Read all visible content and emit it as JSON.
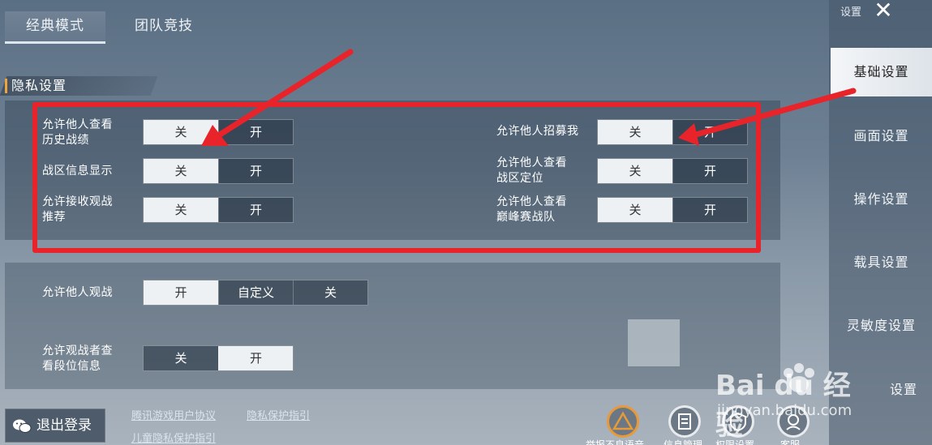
{
  "tabs": [
    "经典模式",
    "团队竞技"
  ],
  "section_title": "隐私设置",
  "privacy": {
    "history": {
      "label_line1": "允许他人查看",
      "label_line2": "历史战绩",
      "off": "关",
      "on": "开",
      "selected": "关"
    },
    "region": {
      "label": "战区信息显示",
      "off": "关",
      "on": "开",
      "selected": "关"
    },
    "spectate_rec": {
      "label_line1": "允许接收观战",
      "label_line2": "推荐",
      "off": "关",
      "on": "开",
      "selected": "关"
    },
    "recruit": {
      "label": "允许他人招募我",
      "off": "关",
      "on": "开",
      "selected": "关"
    },
    "region_loc": {
      "label_line1": "允许他人查看",
      "label_line2": "战区定位",
      "off": "关",
      "on": "开",
      "selected": "关"
    },
    "peak_team": {
      "label_line1": "允许他人查看",
      "label_line2": "巅峰赛战队",
      "off": "关",
      "on": "开",
      "selected": "关"
    }
  },
  "spectate": {
    "allow": {
      "label": "允许他人观战",
      "options": [
        "开",
        "自定义",
        "关"
      ],
      "selected": "开"
    },
    "rank": {
      "label_line1": "允许观战者查",
      "label_line2": "看段位信息",
      "off": "关",
      "on": "开",
      "selected": "开"
    }
  },
  "sidebar": {
    "title": "设置",
    "items": [
      "基础设置",
      "画面设置",
      "操作设置",
      "载具设置",
      "灵敏度设置",
      "设置"
    ]
  },
  "bottom": {
    "logout": "退出登录",
    "links": [
      "腾讯游戏用户协议",
      "隐私保护指引",
      "儿童隐私保护指引"
    ],
    "icons": [
      {
        "name": "warning-icon",
        "label": "举报不良语音"
      },
      {
        "name": "info-manage-icon",
        "label": "信息管理"
      },
      {
        "name": "shield-icon",
        "label": "权限设置"
      },
      {
        "name": "service-icon",
        "label": "客服"
      }
    ]
  },
  "watermark": {
    "text": "Bai du 经验",
    "url": "jingyan.baidu.com"
  },
  "colors": {
    "highlight": "#e8242a",
    "arrow": "#e8242a",
    "accent": "#f0a53a"
  }
}
